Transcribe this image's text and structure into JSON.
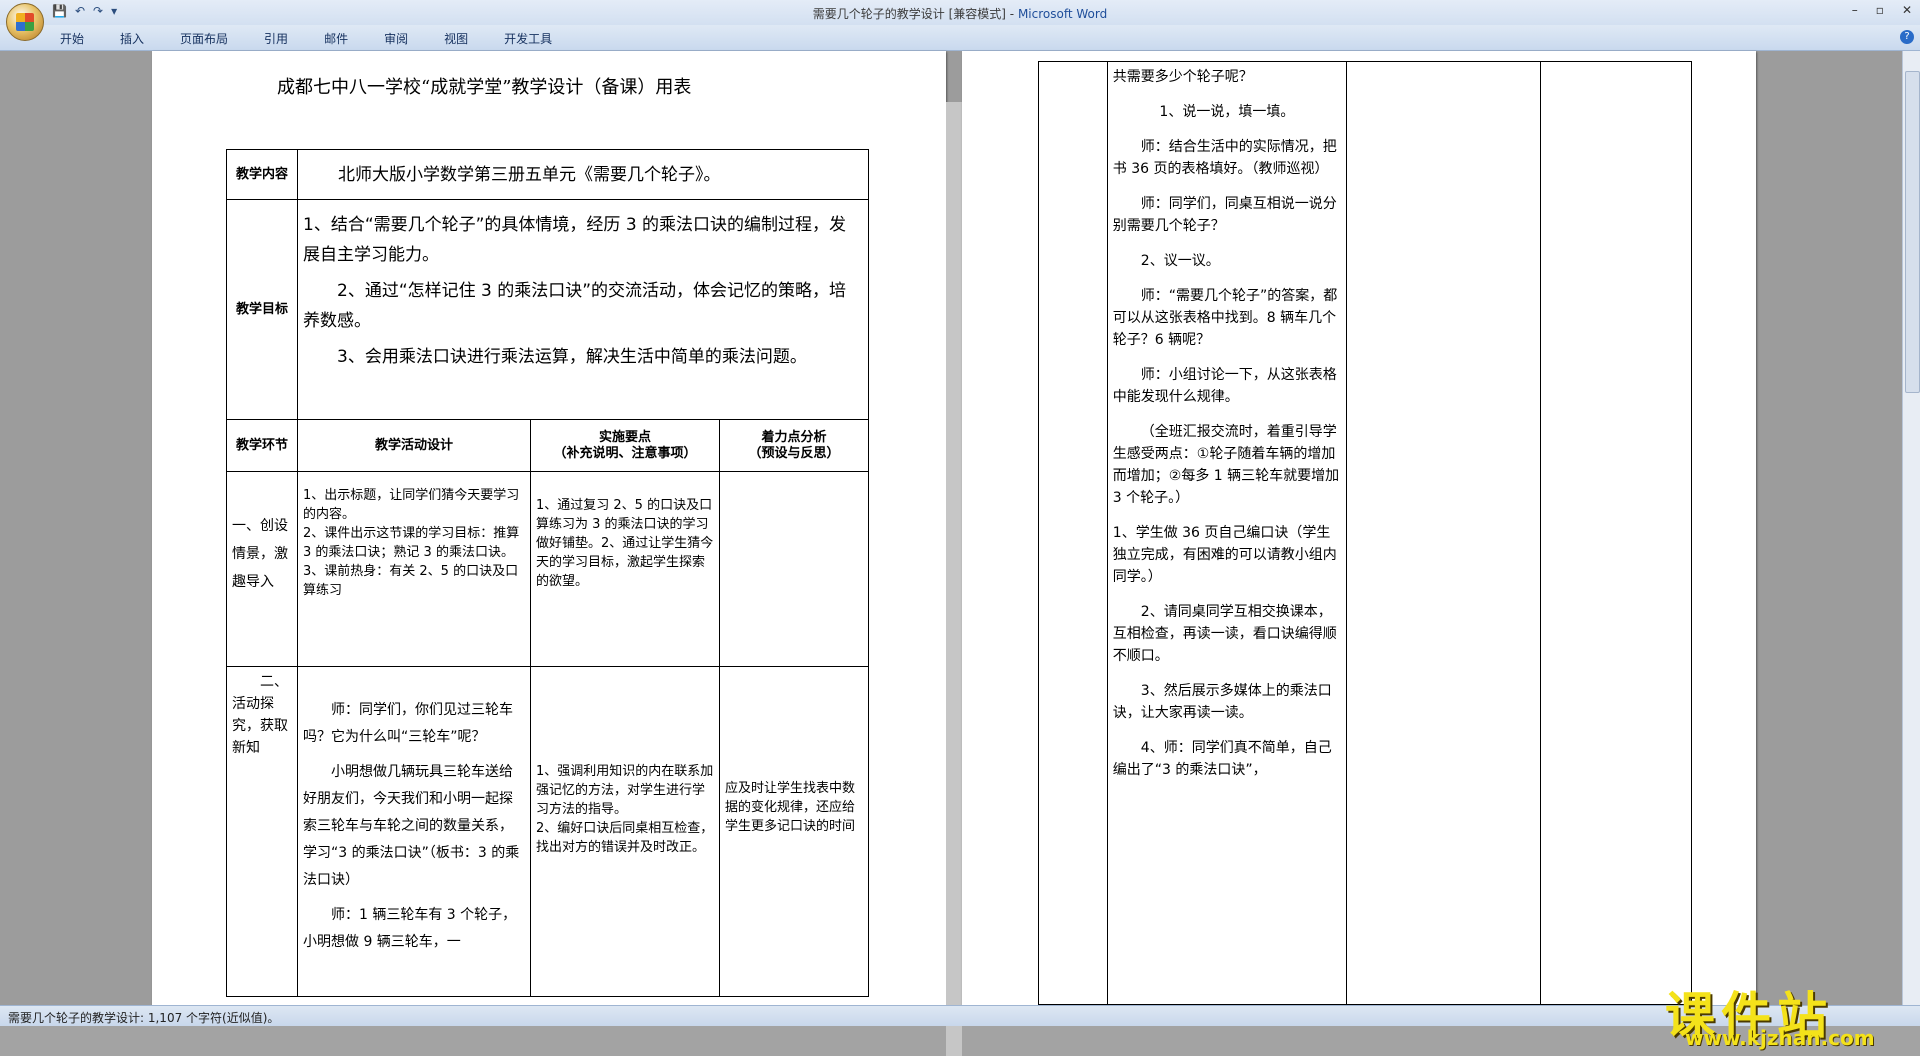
{
  "window": {
    "title_doc": "需要几个轮子的教学设计 [兼容模式]",
    "title_sep": " - ",
    "title_app": "Microsoft Word",
    "qat": [
      "💾",
      "↶",
      "↷",
      "▾"
    ],
    "controls": [
      "–",
      "▫",
      "✕"
    ]
  },
  "ribbon": {
    "tabs": [
      "开始",
      "插入",
      "页面布局",
      "引用",
      "邮件",
      "审阅",
      "视图",
      "开发工具"
    ],
    "help": "?"
  },
  "status": {
    "text": "需要几个轮子的教学设计: 1,107 个字符(近似值)。"
  },
  "doc": {
    "title": "成都七中八一学校“成就学堂”教学设计（备课）用表",
    "content_label": "教学内容",
    "content_text": "北师大版小学数学第三册五单元《需要几个轮子》。",
    "goal_label": "教学目标",
    "goals": [
      "1、结合“需要几个轮子”的具体情境，经历 3 的乘法口诀的编制过程，发展自主学习能力。",
      "2、通过“怎样记住 3 的乘法口诀”的交流活动，体会记忆的策略，培养数感。",
      "3、会用乘法口诀进行乘法运算，解决生活中简单的乘法问题。"
    ],
    "headers": {
      "stage": "教学环节",
      "activity": "教学活动设计",
      "points": "实施要点",
      "points_sub": "（补充说明、注意事项）",
      "analysis": "着力点分析",
      "analysis_sub": "（预设与反思）"
    },
    "row1": {
      "stage": "一、创设情景，激趣导入",
      "activity": [
        "1、出示标题，让同学们猜今天要学习的内容。",
        "2、课件出示这节课的学习目标：推算 3 的乘法口诀；熟记 3 的乘法口诀。",
        "3、课前热身：有关 2、5 的口诀及口算练习"
      ],
      "points": "1、通过复习 2、5 的口诀及口算练习为 3 的乘法口诀的学习做好铺垫。2、通过让学生猜今天的学习目标，激起学生探索的欲望。"
    },
    "row2": {
      "stage": "二、活动探究，获取新知",
      "activity": [
        "师：同学们，你们见过三轮车吗？它为什么叫“三轮车”呢？",
        "小明想做几辆玩具三轮车送给好朋友们，今天我们和小明一起探索三轮车与车轮之间的数量关系，学习“3 的乘法口诀”（板书：3 的乘法口诀）",
        "师：1 辆三轮车有 3 个轮子，小明想做 9 辆三轮车，一"
      ],
      "points": [
        "1、强调利用知识的内在联系加强记忆的方法，对学生进行学习方法的指导。",
        "2、编好口诀后同桌相互检查，找出对方的错误并及时改正。"
      ],
      "analysis": "应及时让学生找表中数据的变化规律，还应给学生更多记口诀的时间"
    },
    "page2": [
      "共需要多少个轮子呢？",
      "1、说一说，填一填。",
      "师：结合生活中的实际情况，把书 36 页的表格填好。（教师巡视）",
      "师：同学们，同桌互相说一说分别需要几个轮子？",
      "2、议一议。",
      "师：“需要几个轮子”的答案，都可以从这张表格中找到。8 辆车几个轮子？6 辆呢？",
      "师：小组讨论一下，从这张表格中能发现什么规律。",
      "（全班汇报交流时，着重引导学生感受两点：①轮子随着车辆的增加而增加；②每多 1 辆三轮车就要增加 3 个轮子。）",
      "1、学生做 36 页自己编口诀（学生独立完成，有困难的可以请教小组内同学。）",
      "2、请同桌同学互相交换课本，互相检查，再读一读，看口诀编得顺不顺口。",
      "3、然后展示多媒体上的乘法口诀，让大家再读一读。",
      "4、师：同学们真不简单，自己编出了“3 的乘法口诀”，"
    ]
  },
  "watermark": {
    "cn": "课件站",
    "url": "www.kjzhan.com"
  }
}
